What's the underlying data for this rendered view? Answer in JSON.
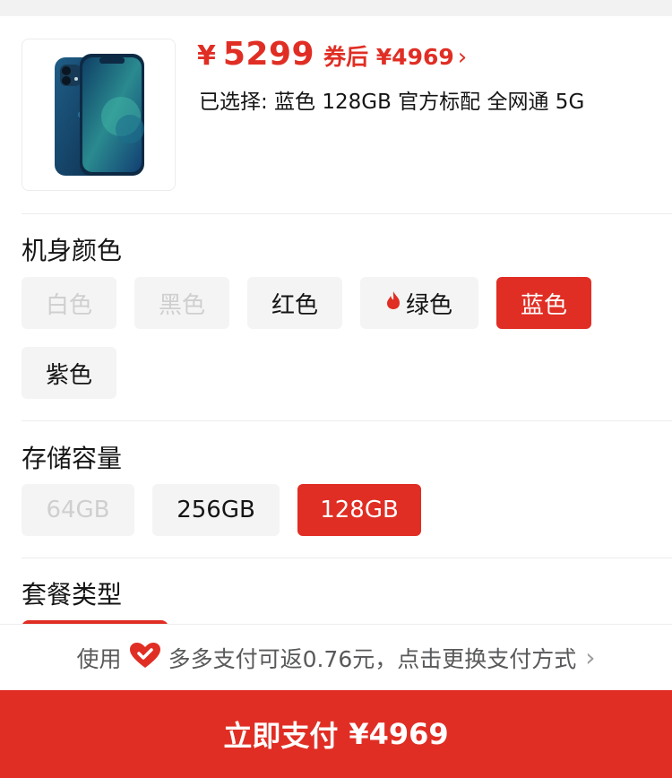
{
  "product": {
    "currency_symbol": "¥",
    "price": "5299",
    "coupon_price": "券后 ¥4969",
    "coupon_arrow": "›",
    "selected_text": "已选择: 蓝色 128GB 官方标配 全网通 5G",
    "image_icon": "phone-image"
  },
  "color_section": {
    "title": "机身颜色",
    "options": [
      {
        "label": "白色",
        "state": "disabled"
      },
      {
        "label": "黑色",
        "state": "disabled"
      },
      {
        "label": "红色",
        "state": "normal"
      },
      {
        "label": "绿色",
        "state": "normal",
        "icon": "fire-icon"
      },
      {
        "label": "蓝色",
        "state": "selected"
      },
      {
        "label": "紫色",
        "state": "normal"
      }
    ]
  },
  "storage_section": {
    "title": "存储容量",
    "options": [
      {
        "label": "64GB",
        "state": "disabled"
      },
      {
        "label": "256GB",
        "state": "normal"
      },
      {
        "label": "128GB",
        "state": "selected"
      }
    ]
  },
  "package_section": {
    "title": "套餐类型"
  },
  "payment": {
    "prefix": "使用",
    "icon": "duoduo-pay-heart-icon",
    "text": "多多支付可返0.76元，点击更换支付方式",
    "chevron": "›"
  },
  "buy_button": {
    "label": "立即支付",
    "amount": "¥4969"
  },
  "colors": {
    "accent": "#e02e24",
    "chip_bg": "#f4f4f4",
    "disabled_text": "#cfcfcf"
  }
}
